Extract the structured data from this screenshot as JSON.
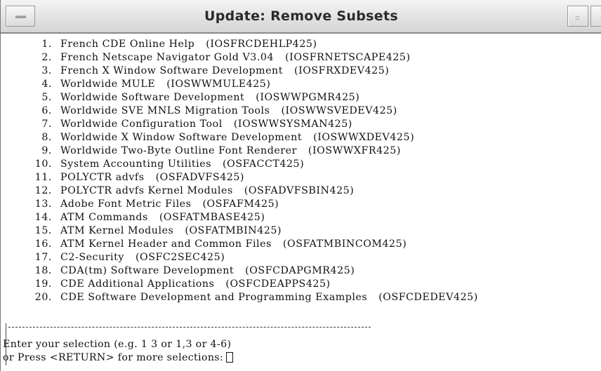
{
  "window": {
    "title": "Update: Remove Subsets"
  },
  "subsets": [
    {
      "number": "1.",
      "name": "French CDE Online Help",
      "code": "(IOSFRCDEHLP425)"
    },
    {
      "number": "2.",
      "name": "French Netscape Navigator Gold V3.04",
      "code": "(IOSFRNETSCAPE425)"
    },
    {
      "number": "3.",
      "name": "French X Window Software Development",
      "code": "(IOSFRXDEV425)"
    },
    {
      "number": "4.",
      "name": "Worldwide MULE",
      "code": "(IOSWWMULE425)"
    },
    {
      "number": "5.",
      "name": "Worldwide Software Development",
      "code": "(IOSWWPGMR425)"
    },
    {
      "number": "6.",
      "name": "Worldwide SVE MNLS Migration Tools",
      "code": "(IOSWWSVEDEV425)"
    },
    {
      "number": "7.",
      "name": "Worldwide Configuration Tool",
      "code": "(IOSWWSYSMAN425)"
    },
    {
      "number": "8.",
      "name": "Worldwide X Window Software Development",
      "code": "(IOSWWXDEV425)"
    },
    {
      "number": "9.",
      "name": "Worldwide Two-Byte Outline Font Renderer",
      "code": "(IOSWWXFR425)"
    },
    {
      "number": "10.",
      "name": "System Accounting Utilities",
      "code": "(OSFACCT425)"
    },
    {
      "number": "11.",
      "name": "POLYCTR advfs",
      "code": "(OSFADVFS425)"
    },
    {
      "number": "12.",
      "name": "POLYCTR advfs Kernel Modules",
      "code": "(OSFADVFSBIN425)"
    },
    {
      "number": "13.",
      "name": "Adobe Font Metric Files",
      "code": "(OSFAFM425)"
    },
    {
      "number": "14.",
      "name": "ATM Commands",
      "code": "(OSFATMBASE425)"
    },
    {
      "number": "15.",
      "name": "ATM Kernel Modules",
      "code": "(OSFATMBIN425)"
    },
    {
      "number": "16.",
      "name": "ATM Kernel Header and Common Files",
      "code": "(OSFATMBINCOM425)"
    },
    {
      "number": "17.",
      "name": "C2-Security",
      "code": "(OSFC2SEC425)"
    },
    {
      "number": "18.",
      "name": "CDA(tm) Software Development",
      "code": "(OSFCDAPGMR425)"
    },
    {
      "number": "19.",
      "name": "CDE Additional Applications",
      "code": "(OSFCDEAPPS425)"
    },
    {
      "number": "20.",
      "name": "CDE Software Development and Programming Examples",
      "code": "(OSFCDEDEV425)"
    }
  ],
  "prompt": {
    "line1": "Enter your selection (e.g. 1 3 or 1,3 or 4-6)",
    "line2": "or Press <RETURN> for more selections:"
  }
}
